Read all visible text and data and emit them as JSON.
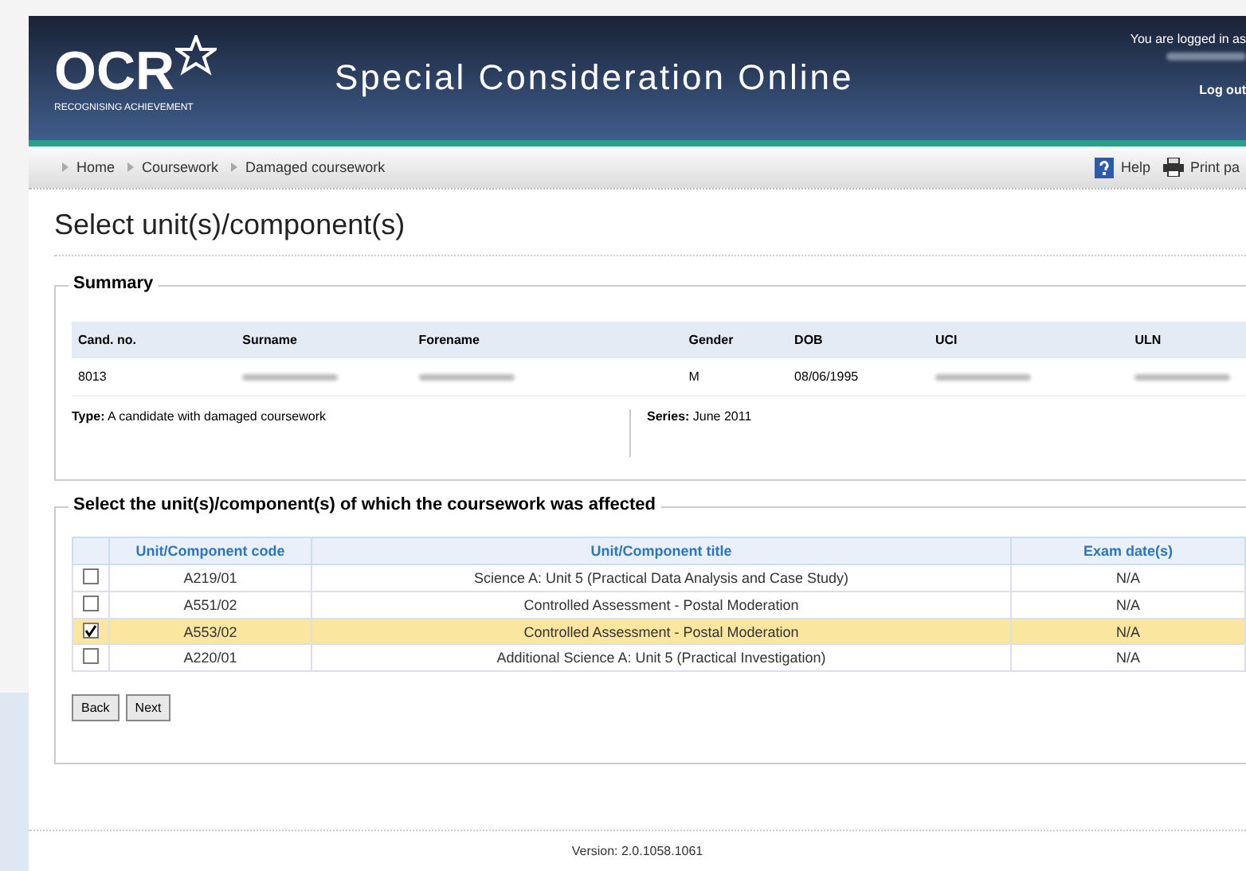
{
  "header": {
    "logo": "OCR",
    "logo_tagline": "RECOGNISING ACHIEVEMENT",
    "title": "Special Consideration Online",
    "login_text": "You are logged in as",
    "logout": "Log out"
  },
  "breadcrumb": [
    "Home",
    "Coursework",
    "Damaged coursework"
  ],
  "tools": [
    {
      "label": "Help",
      "kind": "help"
    },
    {
      "label": "Print pa",
      "kind": "print"
    }
  ],
  "page_title": "Select unit(s)/component(s)",
  "summary": {
    "legend": "Summary",
    "columns": [
      "Cand. no.",
      "Surname",
      "Forename",
      "Gender",
      "DOB",
      "UCI",
      "ULN"
    ],
    "row": [
      {
        "kind": "text",
        "text": "8013"
      },
      {
        "kind": "blurred"
      },
      {
        "kind": "blurred"
      },
      {
        "kind": "text",
        "text": "M"
      },
      {
        "kind": "text",
        "text": "08/06/1995"
      },
      {
        "kind": "blurred"
      },
      {
        "kind": "blurred"
      }
    ],
    "type_label": "Type:",
    "type_value": "A candidate with damaged coursework",
    "series_label": "Series:",
    "series_value": "June 2011"
  },
  "units": {
    "legend": "Select the unit(s)/component(s) of which the coursework was affected",
    "columns": [
      "Unit/Component code",
      "Unit/Component title",
      "Exam date(s)"
    ],
    "rows": [
      {
        "code": "A219/01",
        "title": "Science A: Unit 5 (Practical Data Analysis and Case Study)",
        "date": "N/A",
        "selected": false
      },
      {
        "code": "A551/02",
        "title": "Controlled Assessment - Postal Moderation",
        "date": "N/A",
        "selected": false
      },
      {
        "code": "A553/02",
        "title": "Controlled Assessment - Postal Moderation",
        "date": "N/A",
        "selected": true
      },
      {
        "code": "A220/01",
        "title": "Additional Science A: Unit 5 (Practical Investigation)",
        "date": "N/A",
        "selected": false
      }
    ]
  },
  "buttons": [
    "Back",
    "Next"
  ],
  "footer": "Version: 2.0.1058.1061"
}
